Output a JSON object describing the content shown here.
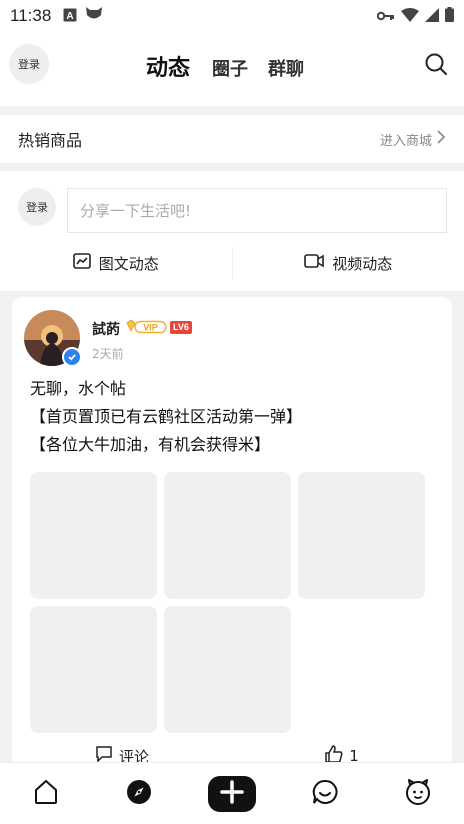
{
  "status_bar": {
    "time": "11:38"
  },
  "header": {
    "login_label": "登录",
    "tabs": [
      {
        "label": "动态"
      },
      {
        "label": "圈子"
      },
      {
        "label": "群聊"
      }
    ]
  },
  "hot_goods": {
    "title": "热销商品",
    "enter_label": "进入商城"
  },
  "composer": {
    "login_label": "登录",
    "placeholder": "分享一下生活吧!",
    "image_post_label": "图文动态",
    "video_post_label": "视频动态"
  },
  "post": {
    "username": "試菂",
    "vip_label": "VIP",
    "level": "LV6",
    "time": "2天前",
    "lines": [
      "无聊，水个帖",
      "【首页置顶已有云鹤社区活动第一弹】",
      "【各位大牛加油，有机会获得米】"
    ],
    "comment_label": "评论",
    "like_count": "1"
  },
  "bottom_nav": {
    "items": [
      "home-icon",
      "compass-icon",
      "add-icon",
      "chat-icon",
      "profile-icon"
    ]
  },
  "colors": {
    "accent_blue": "#2e82f0",
    "level_red": "#e8463a",
    "vip_gold": "#f0b030"
  }
}
